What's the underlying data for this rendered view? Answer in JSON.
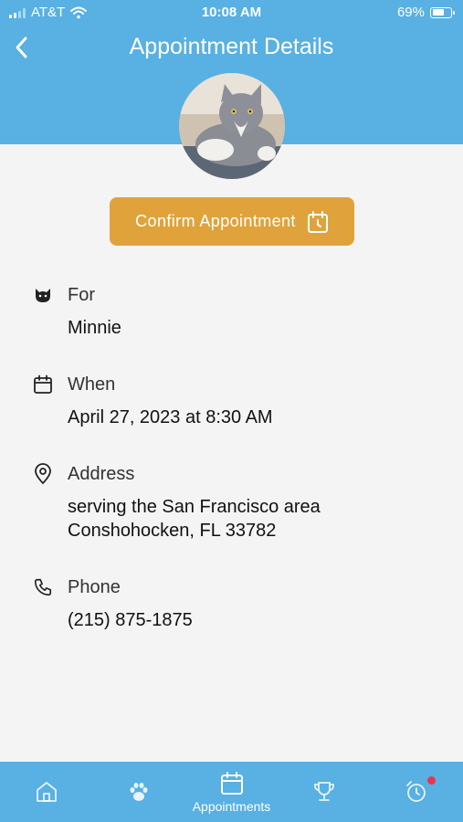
{
  "status_bar": {
    "carrier": "AT&T",
    "time": "10:08 AM",
    "battery": "69%",
    "battery_level": 0.69
  },
  "header": {
    "title": "Appointment Details",
    "back_icon": "chevron-left-icon"
  },
  "avatar": {
    "subject": "gray-and-white cat photo"
  },
  "confirm": {
    "label": "Confirm Appointment",
    "icon": "calendar-clock-icon"
  },
  "details": {
    "for": {
      "label": "For",
      "value": "Minnie",
      "icon": "cat-icon"
    },
    "when": {
      "label": "When",
      "value": "April 27, 2023 at 8:30 AM",
      "icon": "calendar-icon"
    },
    "address": {
      "label": "Address",
      "line1": "serving the San Francisco area",
      "line2": "Conshohocken, FL 33782",
      "icon": "map-pin-icon"
    },
    "phone": {
      "label": "Phone",
      "value": "(215) 875-1875",
      "icon": "phone-icon"
    }
  },
  "tabbar": {
    "tabs": [
      {
        "icon": "home-icon",
        "label": ""
      },
      {
        "icon": "paw-icon",
        "label": ""
      },
      {
        "icon": "calendar-icon",
        "label": "Appointments",
        "active": true
      },
      {
        "icon": "trophy-icon",
        "label": ""
      },
      {
        "icon": "alarm-clock-icon",
        "label": "",
        "badge": true
      }
    ]
  },
  "colors": {
    "primary": "#58b0e3",
    "accent": "#e0a33b",
    "badge": "#e8374a",
    "background": "#f4f4f4"
  }
}
